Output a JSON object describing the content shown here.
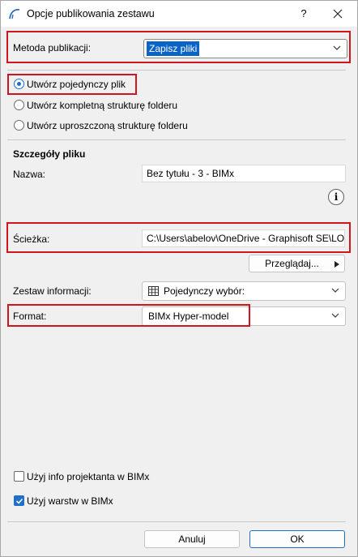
{
  "window": {
    "title": "Opcje publikowania zestawu",
    "help_label": "?"
  },
  "publish_method": {
    "label": "Metoda publikacji:",
    "value": "Zapisz pliki"
  },
  "file_structure": {
    "options": [
      {
        "label": "Utwórz pojedynczy plik",
        "selected": true
      },
      {
        "label": "Utwórz kompletną strukturę folderu",
        "selected": false
      },
      {
        "label": "Utwórz uproszczoną strukturę folderu",
        "selected": false
      }
    ]
  },
  "file_details": {
    "heading": "Szczegóły pliku",
    "name_label": "Nazwa:",
    "name_value": "Bez tytułu - 3 - BIMx",
    "path_label": "Ścieżka:",
    "path_value": "C:\\Users\\abelov\\OneDrive - Graphisoft SE\\LOC LIBR",
    "browse_label": "Przeglądaj..."
  },
  "info_set": {
    "label": "Zestaw informacji:",
    "value": "Pojedynczy wybór:"
  },
  "format": {
    "label": "Format:",
    "value": "BIMx Hyper-model"
  },
  "checkboxes": [
    {
      "label": "Użyj info projektanta w BIMx",
      "checked": false
    },
    {
      "label": "Użyj warstw w BIMx",
      "checked": true
    }
  ],
  "footer": {
    "cancel_label": "Anuluj",
    "ok_label": "OK"
  },
  "colors": {
    "highlight": "#d2141c",
    "accent": "#1e6fc9",
    "selection": "#0a64c8"
  },
  "icons": [
    "archicad-icon",
    "close-icon",
    "chevron-down-icon",
    "info-icon",
    "play-icon",
    "table-icon",
    "checkmark-icon"
  ]
}
